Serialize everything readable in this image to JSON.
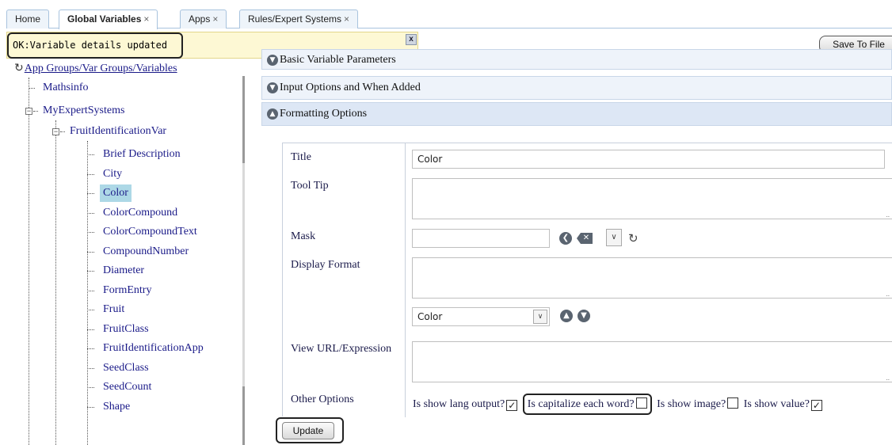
{
  "tabs": [
    {
      "label": "Home",
      "closable": false,
      "active": false
    },
    {
      "label": "Global Variables",
      "closable": true,
      "active": true
    },
    {
      "label": "Apps",
      "closable": true,
      "active": false
    },
    {
      "label": "Rules/Expert Systems",
      "closable": true,
      "active": false
    }
  ],
  "tab_close_glyph": "×",
  "notification": {
    "message": "OK:Variable details updated",
    "close_label": "x"
  },
  "toolbar": {
    "save_label": "Save To File"
  },
  "tree": {
    "root_label": "App Groups/Var Groups/Variables",
    "level1": [
      "Mathsinfo",
      "MyExpertSystems"
    ],
    "level2": [
      "FruitIdentificationVar"
    ],
    "leaves": [
      "Brief Description",
      "City",
      "Color",
      "ColorCompound",
      "ColorCompoundText",
      "CompoundNumber",
      "Diameter",
      "FormEntry",
      "Fruit",
      "FruitClass",
      "FruitIdentificationApp",
      "SeedClass",
      "SeedCount",
      "Shape"
    ],
    "selected": "Color"
  },
  "accordion": {
    "basic": "Basic Variable Parameters",
    "input": "Input Options and When Added",
    "formatting": "Formatting Options"
  },
  "form": {
    "title_label": "Title",
    "title_value": "Color",
    "tooltip_label": "Tool Tip",
    "tooltip_value": "",
    "mask_label": "Mask",
    "mask_value": "",
    "display_format_label": "Display Format",
    "display_format_value": "",
    "field_select_value": "Color",
    "view_url_label": "View URL/Expression",
    "view_url_value": "",
    "other_options_label": "Other Options",
    "options": [
      {
        "label": "Is show lang output?",
        "checked": true
      },
      {
        "label": "Is capitalize each word?",
        "checked": false
      },
      {
        "label": "Is show image?",
        "checked": false
      },
      {
        "label": "Is show value?",
        "checked": true
      }
    ],
    "update_label": "Update"
  },
  "icons": {
    "root": "refresh-icon",
    "accordion_collapsed": "chevron-down-circle-icon",
    "accordion_expanded": "chevron-up-circle-icon",
    "mask_back": "chevron-left-circle-icon",
    "mask_clear": "clear-icon",
    "mask_dropdown": "chevron-down-icon",
    "mask_refresh": "refresh-icon",
    "move_up": "chevron-up-circle-icon",
    "move_down": "chevron-down-circle-icon"
  },
  "colors": {
    "selection": "#add8e6",
    "notification_bg": "#fdf8d4",
    "link": "#1a1a88"
  }
}
